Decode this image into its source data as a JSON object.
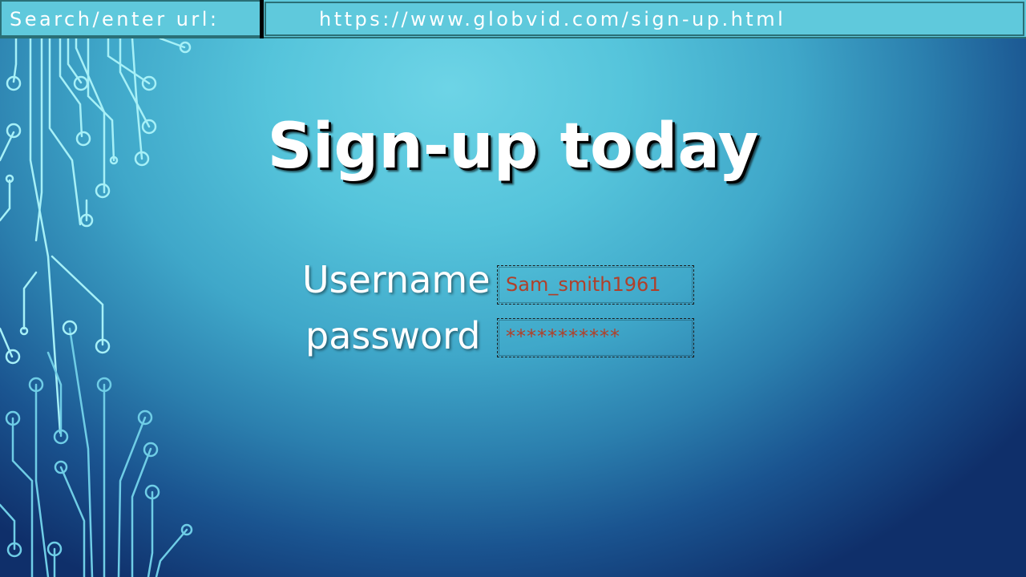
{
  "address_bar": {
    "label": "Search/enter url:",
    "url": "https://www.globvid.com/sign-up.html"
  },
  "signup": {
    "title": "Sign-up today",
    "username_label": "Username",
    "username_value": "Sam_smith1961",
    "password_label": "password",
    "password_value": "***********"
  },
  "colors": {
    "background_light": "#6dd4e6",
    "background_dark": "#0f2f6a",
    "field_text": "#b0402a",
    "circuit_lines": "#8fe8f3"
  }
}
